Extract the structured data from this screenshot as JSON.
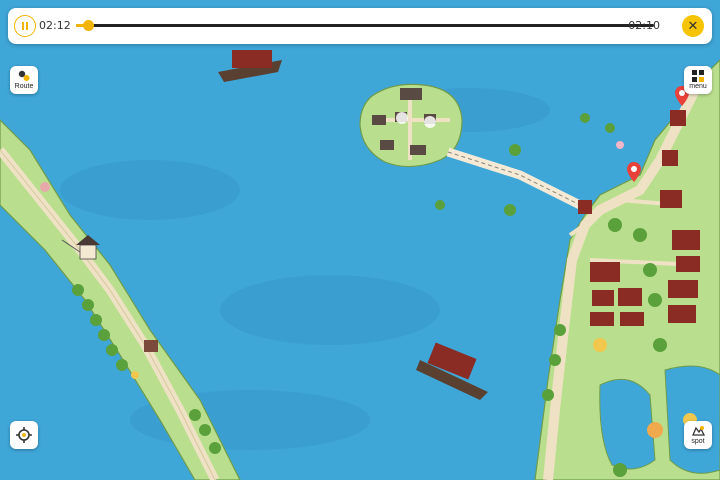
{
  "player": {
    "current_time": "02:12",
    "total_time": "02:10",
    "progress_percent": 2
  },
  "controls": {
    "route_label": "Route",
    "menu_label": "menu",
    "spot_label": "spot"
  },
  "colors": {
    "water": "#3fa6d8",
    "land": "#b9df8e",
    "path": "#efe2c4",
    "accent": "#f3b400",
    "pin": "#e8413a",
    "roof": "#8a2b24"
  },
  "icons": {
    "pause": "pause-icon",
    "close": "close-icon",
    "route": "route-icon",
    "menu": "grid-icon",
    "locate": "locate-icon",
    "spot": "spot-icon",
    "pin": "map-pin-icon"
  }
}
